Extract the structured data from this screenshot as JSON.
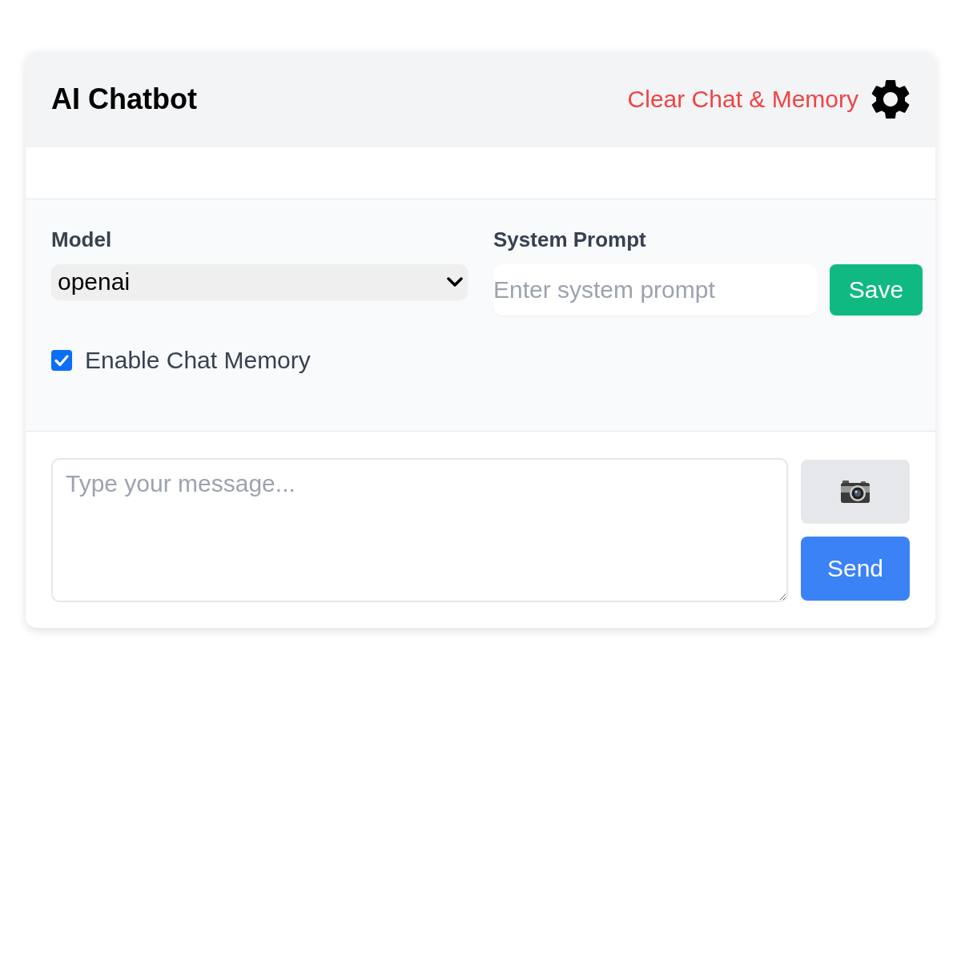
{
  "header": {
    "title": "AI Chatbot",
    "clear_button": "Clear Chat & Memory"
  },
  "settings": {
    "model": {
      "label": "Model",
      "value": "openai"
    },
    "system_prompt": {
      "label": "System Prompt",
      "placeholder": "Enter system prompt",
      "button": "Save"
    },
    "memory": {
      "label": "Enable Chat Memory",
      "checked": true
    }
  },
  "composer": {
    "placeholder": "Type your message...",
    "send_button": "Send"
  }
}
